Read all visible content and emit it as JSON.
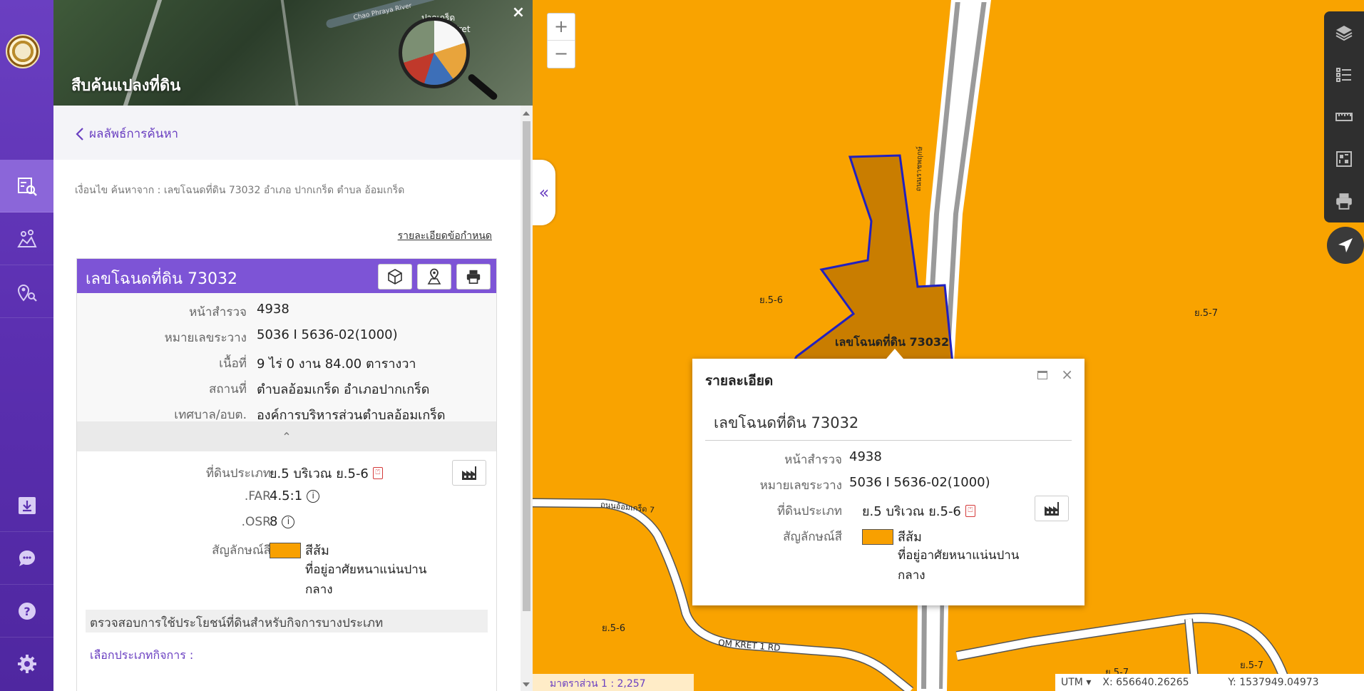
{
  "panel": {
    "title": "สืบค้นแปลงที่ดิน",
    "back_label": "ผลลัพธ์การค้นหา",
    "criteria": "เงื่อนไข ค้นหาจาก : เลขโฉนดที่ดิน 73032 อำเภอ ปากเกร็ด ตำบล อ้อมเกร็ด",
    "detail_link": "รายละเอียดข้อกำหนด",
    "hero_labels": [
      "ปากเกร็ด",
      "Kret",
      "Chao Phraya River"
    ],
    "close_glyph": "×"
  },
  "card": {
    "title": "เลขโฉนดที่ดิน 73032",
    "rows": [
      {
        "label": "หน้าสำรวจ",
        "value": "4938"
      },
      {
        "label": "หมายเลขระวาง",
        "value": "5036 I 5636-02(1000)"
      },
      {
        "label": "เนื้อที่",
        "value": "9 ไร่ 0 งาน 84.00 ตารางวา"
      },
      {
        "label": "สถานที่",
        "value": "ตำบลอ้อมเกร็ด อำเภอปากเกร็ด"
      },
      {
        "label": "เทศบาล/อบต.",
        "value": "องค์การบริหารส่วนตำบลอ้อมเกร็ด"
      }
    ],
    "collapse_glyph": "⌃",
    "zone": {
      "type_label": "ที่ดินประเภท",
      "type_value": "ย.5 บริเวณ ย.5-6",
      "far_label": ".FAR",
      "far_value": "4.5:1",
      "osr_label": ".OSR",
      "osr_value": "8",
      "symbol_label": "สัญลักษณ์สี",
      "symbol_name": "สีส้ม",
      "symbol_desc_1": "ที่อยู่อาศัยหนาแน่นปาน",
      "symbol_desc_2": "กลาง",
      "swatch_color": "#f8a000"
    },
    "check_bar": "ตรวจสอบการใช้ประโยชน์ที่ดินสำหรับกิจการบางประเภท",
    "choose_label": "เลือกประเภทกิจการ :"
  },
  "map": {
    "zoom_in": "+",
    "zoom_out": "−",
    "collapse_glyph": "«",
    "labels": {
      "zone_left_top": "ย.5-6",
      "zone_right": "ย.5-7",
      "zone_left_bottom": "ย.5-6",
      "zone_bottom_1": "ย.5-7",
      "zone_bottom_2": "ย.5-7",
      "parcel": "เลขโฉนดที่ดิน 73032",
      "road_1": "ถนนอ้อมเกร็ด 7",
      "road_2": "OM KRET 1 RD",
      "road_vertical": "ถนนราชพฤกษ์"
    },
    "popup": {
      "header": "รายละเอียด",
      "close": "×",
      "name": "เลขโฉนดที่ดิน 73032",
      "rows": [
        {
          "label": "หน้าสำรวจ",
          "value": "4938"
        },
        {
          "label": "หมายเลขระวาง",
          "value": "5036 I 5636-02(1000)"
        }
      ],
      "type_label": "ที่ดินประเภท",
      "type_value": "ย.5 บริเวณ ย.5-6",
      "symbol_label": "สัญลักษณ์สี",
      "symbol_name": "สีส้ม",
      "symbol_desc_1": "ที่อยู่อาศัยหนาแน่นปาน",
      "symbol_desc_2": "กลาง"
    },
    "scale": "มาตราส่วน 1 : 2,257",
    "coords": {
      "system": "UTM ▾",
      "x": "X: 656640.26265",
      "y": "Y: 1537949.04973"
    },
    "colors": {
      "zone": "#f9a300",
      "parcel_fill": "#c97d00",
      "parcel_stroke": "#2020c0",
      "road": "#ffffff"
    }
  }
}
